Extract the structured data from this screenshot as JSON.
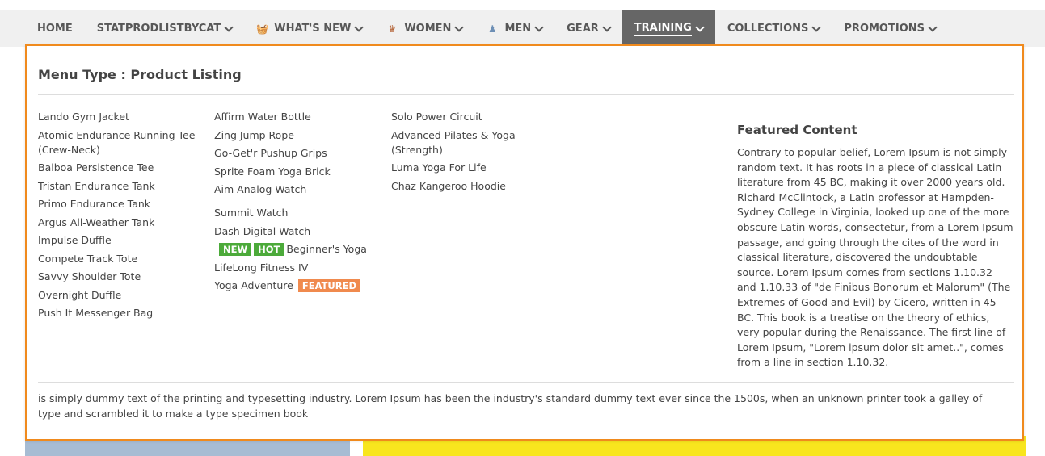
{
  "nav": {
    "items": [
      {
        "label": "HOME"
      },
      {
        "label": "STATPRODLISTBYCAT"
      },
      {
        "label": "WHAT'S NEW",
        "icon": "basket-icon"
      },
      {
        "label": "WOMEN",
        "icon": "woman-icon"
      },
      {
        "label": "MEN",
        "icon": "man-icon"
      },
      {
        "label": "GEAR"
      },
      {
        "label": "TRAINING"
      },
      {
        "label": "COLLECTIONS"
      },
      {
        "label": "PROMOTIONS"
      }
    ],
    "active": "TRAINING"
  },
  "dropdown": {
    "menu_type": "Menu Type : Product Listing",
    "col1": [
      "Lando Gym Jacket",
      "Atomic Endurance Running Tee (Crew-Neck)",
      "Balboa Persistence Tee",
      "Tristan Endurance Tank",
      "Primo Endurance Tank",
      "Argus All-Weather Tank",
      "Impulse Duffle",
      "Compete Track Tote",
      "Savvy Shoulder Tote",
      "Overnight Duffle",
      "Push It Messenger Bag"
    ],
    "col2": [
      "Affirm Water Bottle",
      "Zing Jump Rope",
      "Go-Get'r Pushup Grips",
      "Sprite Foam Yoga Brick",
      "Aim Analog Watch",
      "Summit Watch",
      "Dash Digital Watch",
      "Beginner's Yoga",
      "LifeLong Fitness IV",
      "Yoga Adventure"
    ],
    "col3": [
      "Solo Power Circuit",
      "Advanced Pilates & Yoga (Strength)",
      "Luma Yoga For Life",
      "Chaz Kangeroo Hoodie"
    ],
    "badges": {
      "new": "NEW",
      "hot": "HOT",
      "featured": "FEATURED"
    },
    "featured": {
      "title": "Featured Content",
      "text": "Contrary to popular belief, Lorem Ipsum is not simply random text. It has roots in a piece of classical Latin literature from 45 BC, making it over 2000 years old. Richard McClintock, a Latin professor at Hampden-Sydney College in Virginia, looked up one of the more obscure Latin words, consectetur, from a Lorem Ipsum passage, and going through the cites of the word in classical literature, discovered the undoubtable source. Lorem Ipsum comes from sections 1.10.32 and 1.10.33 of \"de Finibus Bonorum et Malorum\" (The Extremes of Good and Evil) by Cicero, written in 45 BC. This book is a treatise on the theory of ethics, very popular during the Renaissance. The first line of Lorem Ipsum, \"Lorem ipsum dolor sit amet..\", comes from a line in section 1.10.32."
    },
    "footer": "is simply dummy text of the printing and typesetting industry. Lorem Ipsum has been the industry's standard dummy text ever since the 1500s, when an unknown printer took a galley of type and scrambled it to make a type specimen book"
  },
  "colors": {
    "accent_border": "#f08a1d",
    "nav_active_bg": "#666666",
    "badge_green": "#4caa3a",
    "badge_orange": "#f08a4e"
  }
}
